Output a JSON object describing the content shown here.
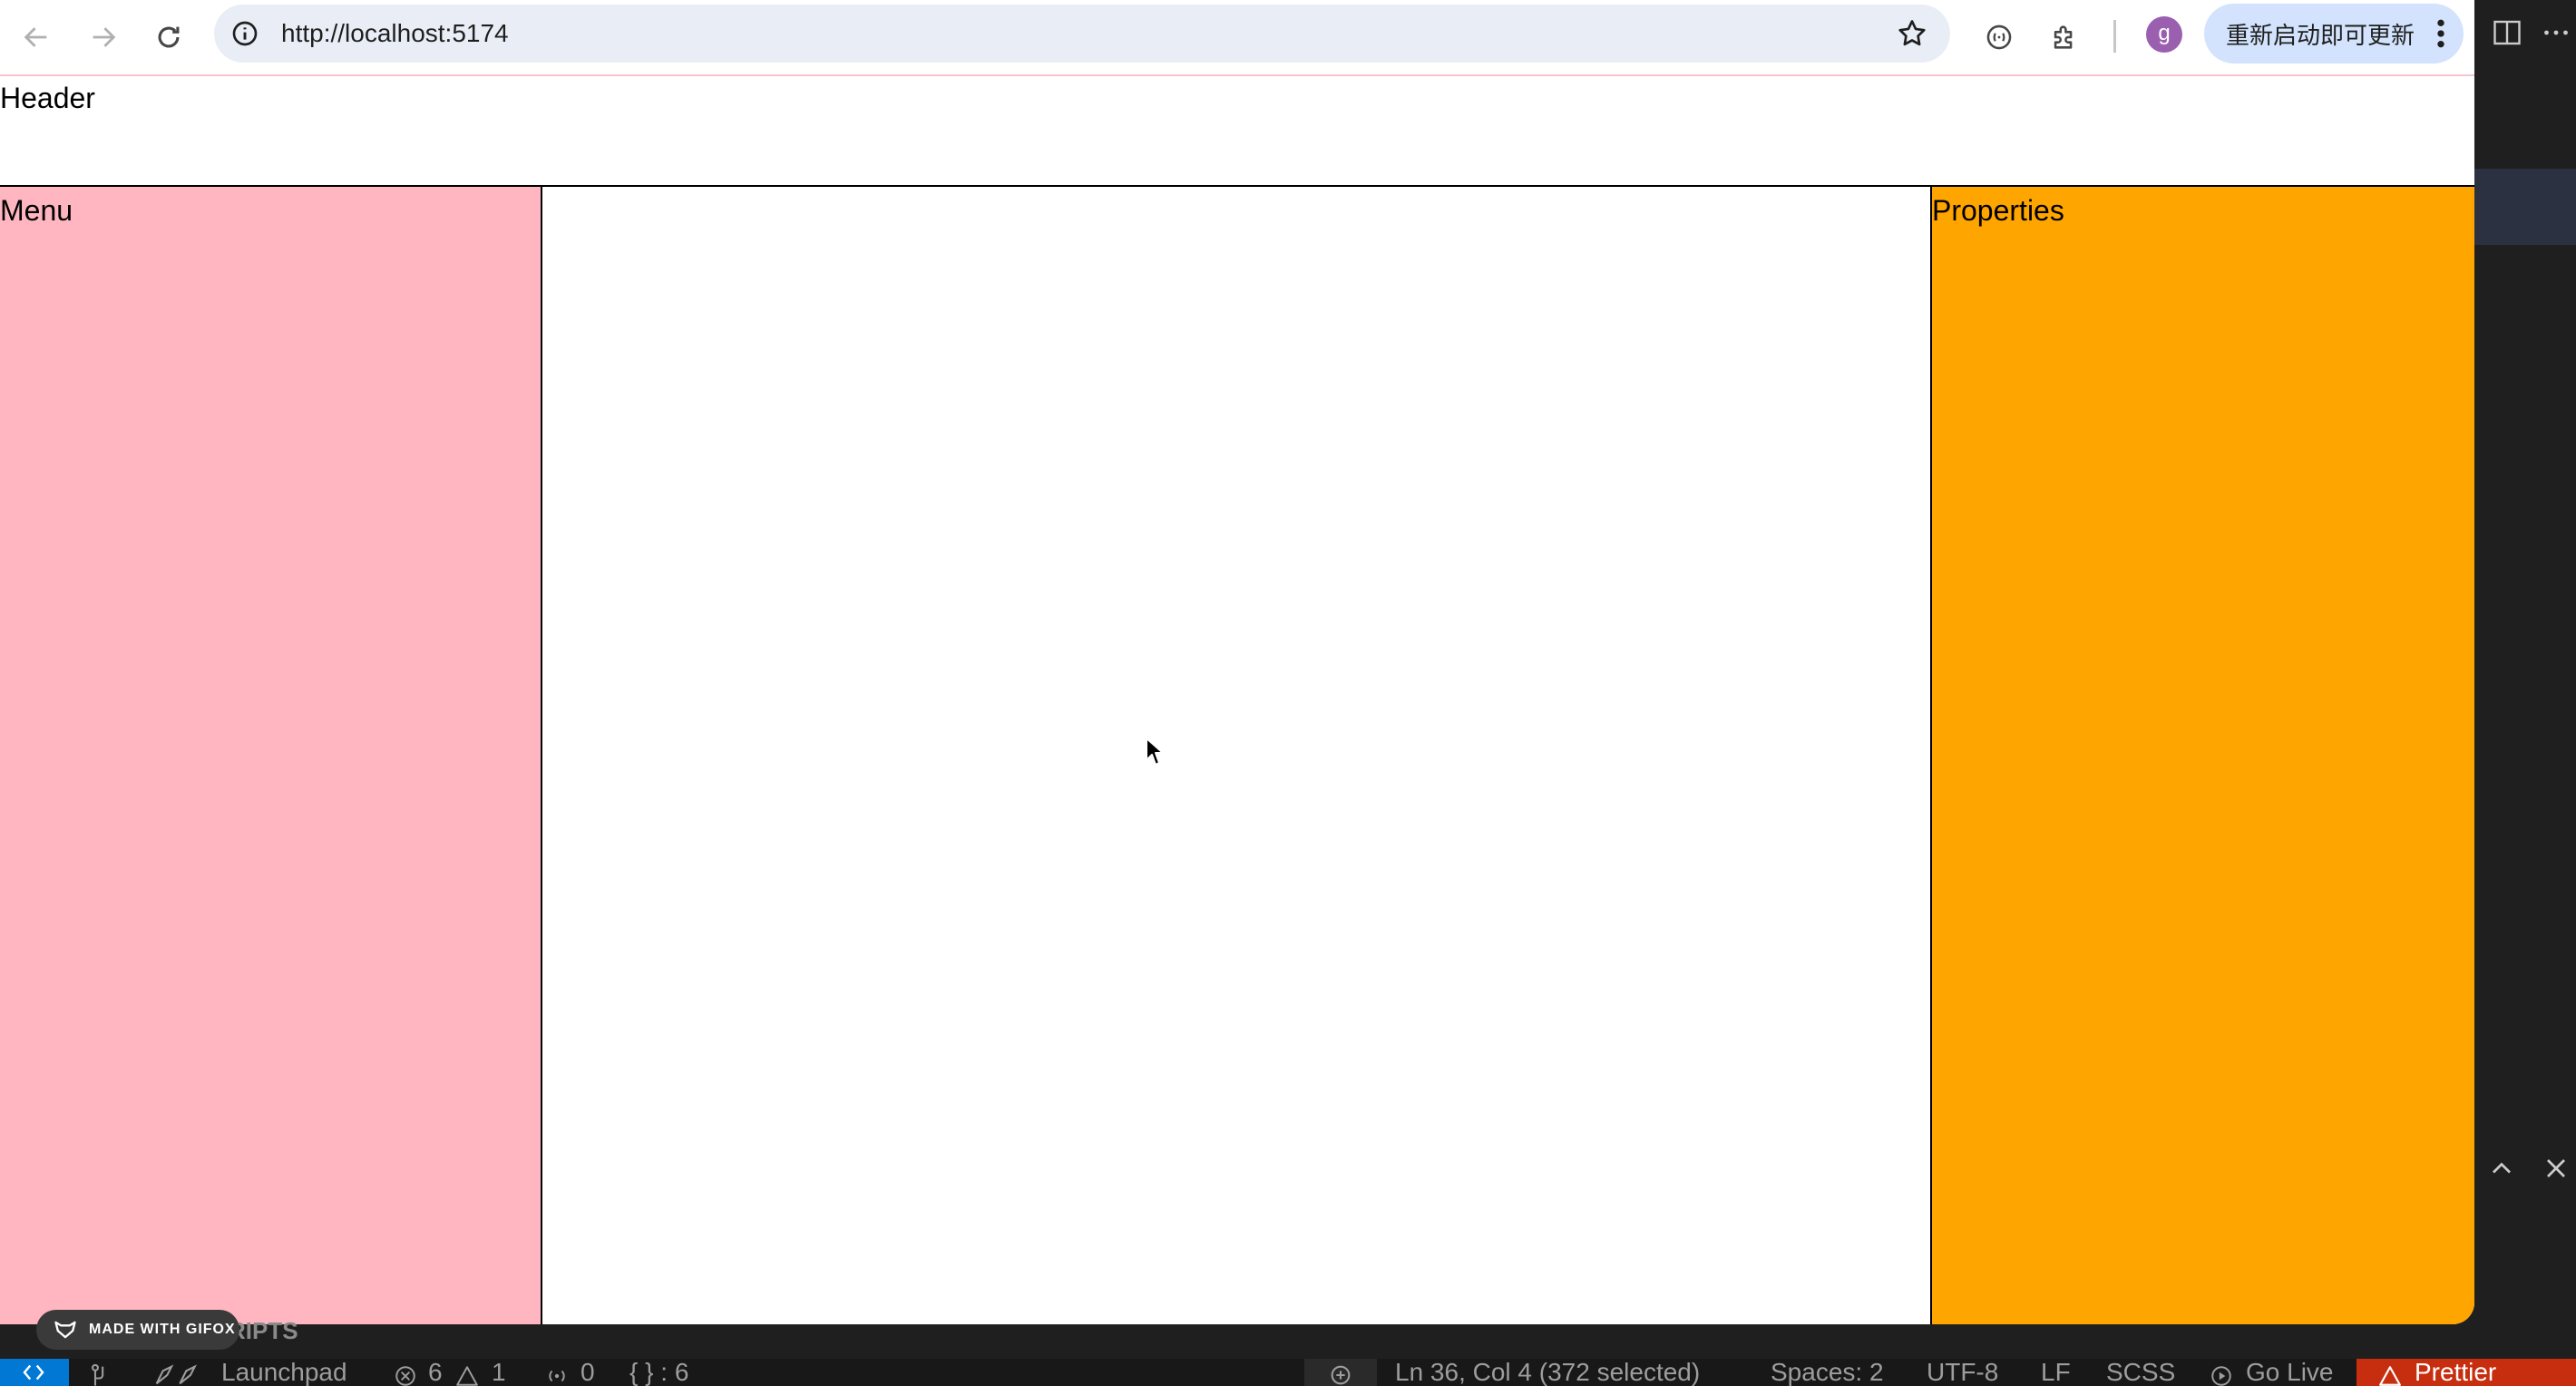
{
  "browser": {
    "url": "http://localhost:5174",
    "profile_initial": "g",
    "update_button_label": "重新启动即可更新",
    "icons": {
      "back": "arrow-left-icon",
      "forward": "arrow-right-icon",
      "reload": "reload-icon",
      "site_info": "info-icon",
      "bookmark": "star-icon",
      "media": "media-icon",
      "extensions": "puzzle-icon",
      "menu": "kebab-icon"
    }
  },
  "page": {
    "header_label": "Header",
    "menu_label": "Menu",
    "properties_label": "Properties",
    "colors": {
      "menu_bg": "#ffb6c1",
      "properties_bg": "#ffa500",
      "canvas_bg": "#ffffff"
    }
  },
  "overlay": {
    "gifox_label": "MADE WITH GIFOX",
    "sidebar_fragment": "RIPTS"
  },
  "statusbar": {
    "launchpad": "Launchpad",
    "errors": "6",
    "warnings": "1",
    "ports": "0",
    "braces": "{ } : 6",
    "cursor_position": "Ln 36, Col 4 (372 selected)",
    "indentation": "Spaces: 2",
    "encoding": "UTF-8",
    "line_ending": "LF",
    "language": "SCSS",
    "go_live": "Go Live",
    "prettier": "Prettier",
    "colors": {
      "remote_bg": "#0078d4",
      "prettier_bg": "#c72e0f"
    }
  }
}
